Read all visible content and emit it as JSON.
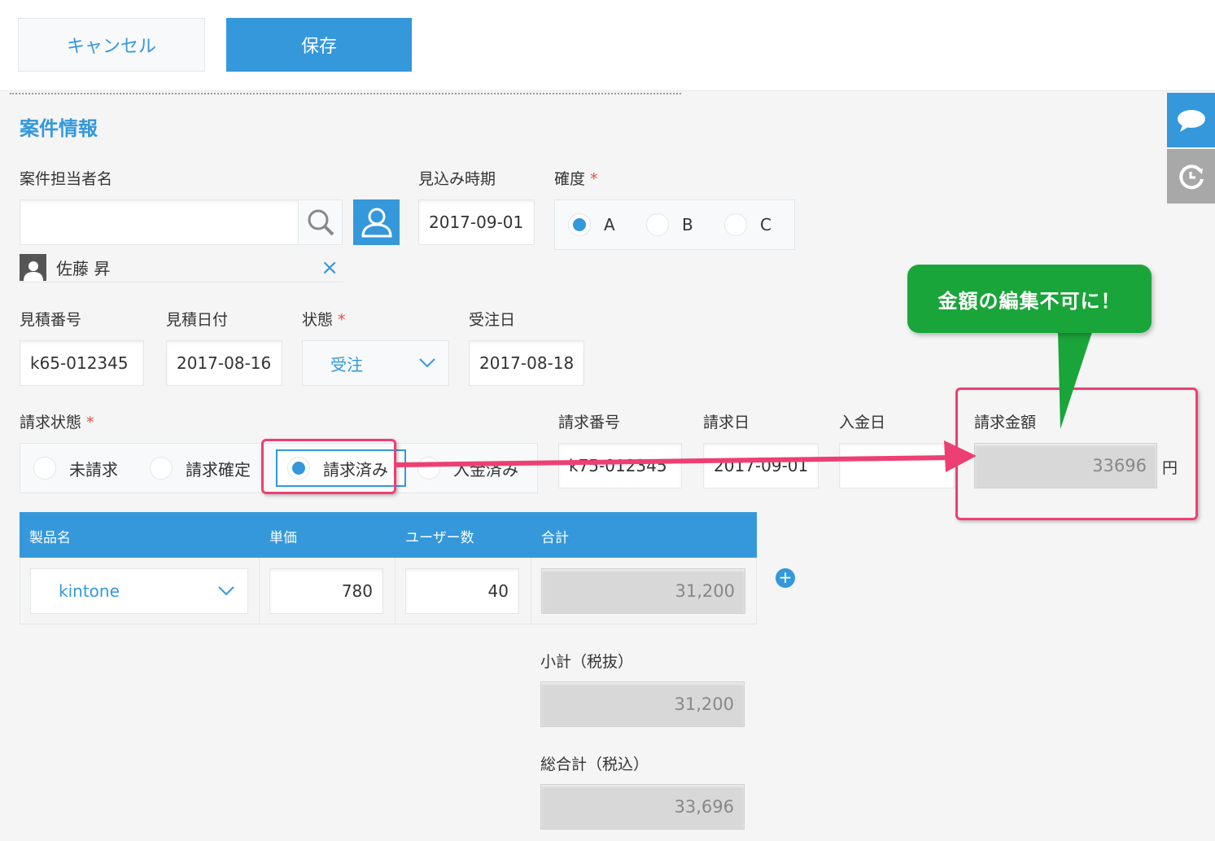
{
  "toolbar": {
    "cancel_label": "キャンセル",
    "save_label": "保存"
  },
  "side": {
    "comment_icon": "comment-icon",
    "history_icon": "history-icon"
  },
  "section": {
    "title": "案件情報"
  },
  "fields": {
    "owner": {
      "label": "案件担当者名",
      "value": "",
      "selected_user": "佐藤 昇"
    },
    "forecast": {
      "label": "見込み時期",
      "value": "2017-09-01"
    },
    "certainty": {
      "label": "確度",
      "required": "*",
      "options": [
        "A",
        "B",
        "C"
      ],
      "selected": "A"
    },
    "quote_no": {
      "label": "見積番号",
      "value": "k65-012345"
    },
    "quote_date": {
      "label": "見積日付",
      "value": "2017-08-16"
    },
    "status": {
      "label": "状態",
      "required": "*",
      "value": "受注"
    },
    "order_date": {
      "label": "受注日",
      "value": "2017-08-18"
    },
    "billing_status": {
      "label": "請求状態",
      "required": "*",
      "options": [
        "未請求",
        "請求確定",
        "請求済み",
        "入金済み"
      ],
      "selected": "請求済み"
    },
    "invoice_no": {
      "label": "請求番号",
      "value": "k75-012345"
    },
    "invoice_date": {
      "label": "請求日",
      "value": "2017-09-01"
    },
    "payment_date": {
      "label": "入金日",
      "value": ""
    },
    "invoice_amount": {
      "label": "請求金額",
      "value": "33696",
      "unit": "円"
    }
  },
  "table": {
    "headers": [
      "製品名",
      "単価",
      "ユーザー数",
      "合計"
    ],
    "rows": [
      {
        "product": "kintone",
        "unit_price": "780",
        "users": "40",
        "total": "31,200"
      }
    ]
  },
  "summary": {
    "subtotal_label": "小計（税抜）",
    "subtotal": "31,200",
    "grand_total_label": "総合計（税込）",
    "grand_total": "33,696"
  },
  "annotation": {
    "callout": "金額の編集不可に！",
    "arrow_color": "#ee3f73",
    "box_color": "#ee3f73",
    "callout_color": "#1aa53a"
  },
  "colors": {
    "accent": "#3498db",
    "required": "#e74c3c"
  }
}
